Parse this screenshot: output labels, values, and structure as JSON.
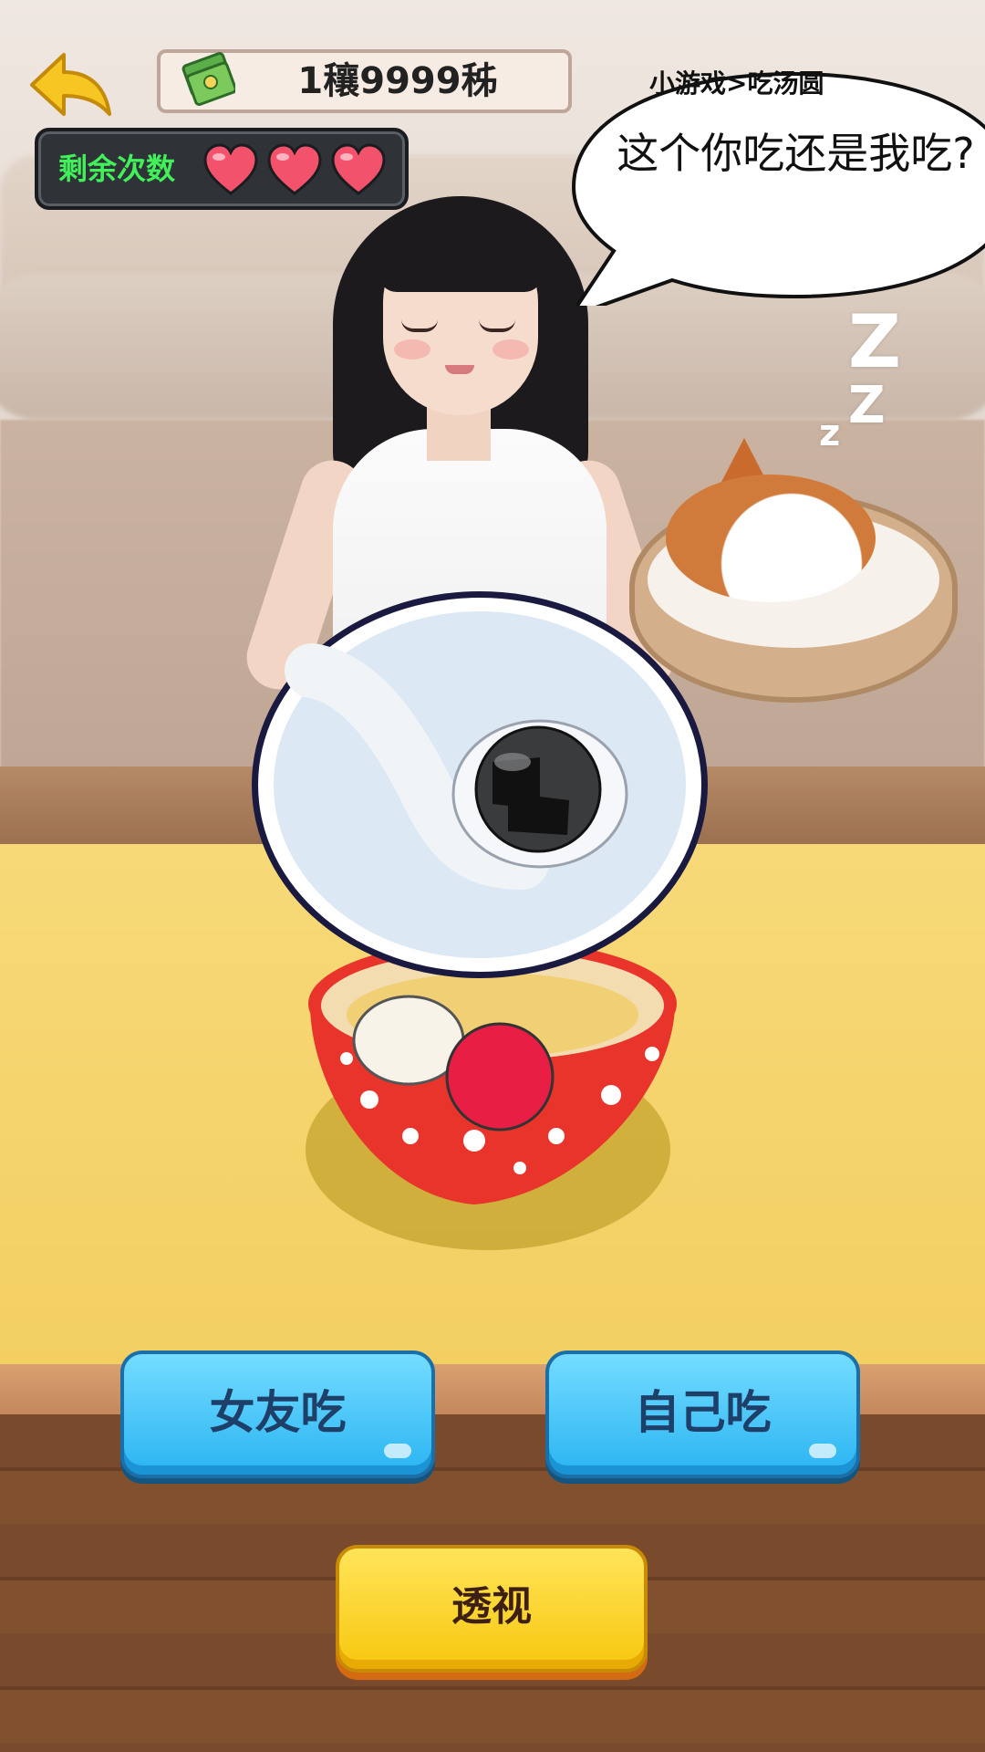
{
  "hud": {
    "currency_value": "1穰9999秭",
    "lives_label": "剩余次数",
    "lives_remaining": 3,
    "lives_max": 3
  },
  "breadcrumb": "小游戏>吃汤圆",
  "dialogue": {
    "speech": "这个你吃还是我吃?"
  },
  "sleep_marks": [
    "Z",
    "Z",
    "z"
  ],
  "buttons": {
    "girlfriend_eats": "女友吃",
    "self_eats": "自己吃",
    "xray": "透视"
  },
  "colors": {
    "lives_text": "#42f05a",
    "blue_button": "#2ab4f2",
    "yellow_button": "#f7c70d",
    "bowl": "#e8342b"
  },
  "icons": {
    "back": "back-arrow-icon",
    "money": "money-stack-icon",
    "heart": "heart-icon"
  }
}
